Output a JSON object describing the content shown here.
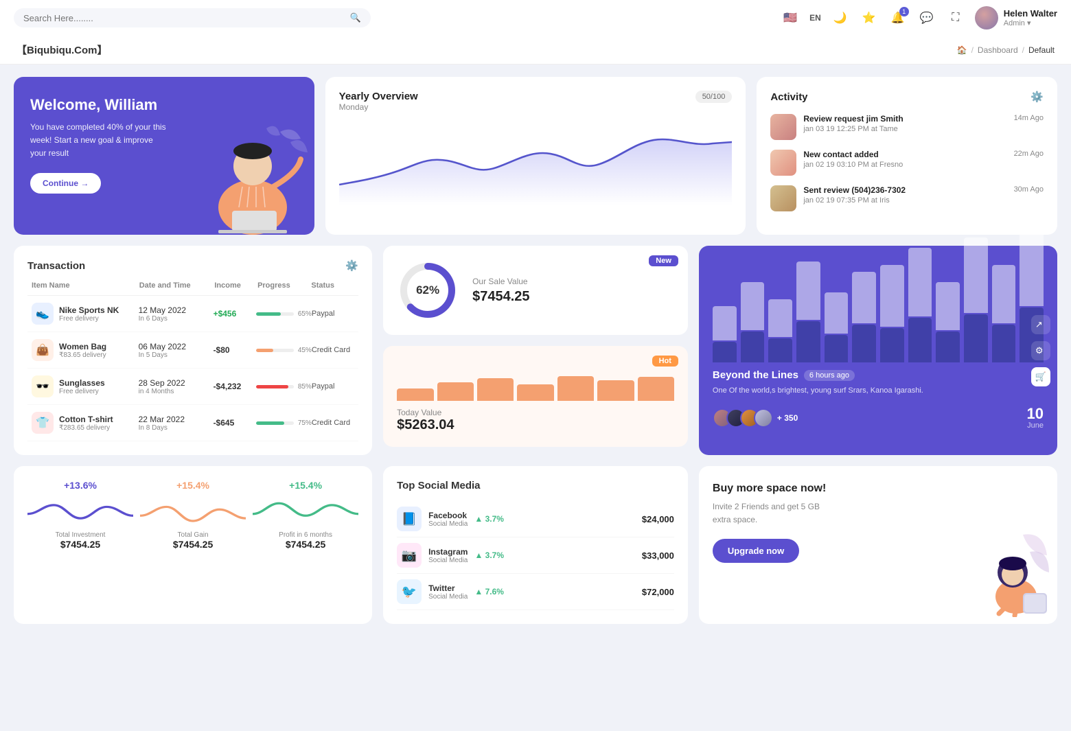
{
  "topnav": {
    "search_placeholder": "Search Here........",
    "lang": "EN",
    "user_name": "Helen Walter",
    "user_role": "Admin ▾",
    "notification_count": "1"
  },
  "breadcrumb": {
    "brand": "【Biqubiqu.Com】",
    "path": [
      "Dashboard",
      "Default"
    ]
  },
  "welcome": {
    "title": "Welcome, William",
    "subtitle": "You have completed 40% of your this week! Start a new goal & improve your result",
    "button": "Continue →"
  },
  "yearly": {
    "title": "Yearly Overview",
    "badge": "50/100",
    "subtitle": "Monday"
  },
  "activity": {
    "title": "Activity",
    "items": [
      {
        "title": "Review request jim Smith",
        "sub": "jan 03 19 12:25 PM at Tame",
        "time": "14m Ago"
      },
      {
        "title": "New contact added",
        "sub": "jan 02 19 03:10 PM at Fresno",
        "time": "22m Ago"
      },
      {
        "title": "Sent review (504)236-7302",
        "sub": "jan 02 19 07:35 PM at Iris",
        "time": "30m Ago"
      }
    ]
  },
  "transaction": {
    "title": "Transaction",
    "columns": [
      "Item Name",
      "Date and Time",
      "Income",
      "Progress",
      "Status"
    ],
    "rows": [
      {
        "name": "Nike Sports NK",
        "sub": "Free delivery",
        "icon": "👟",
        "icon_bg": "#e8f0ff",
        "date": "12 May 2022",
        "days": "In 6 Days",
        "income": "+$456",
        "positive": true,
        "progress": 65,
        "progress_color": "#44bb88",
        "status": "Paypal"
      },
      {
        "name": "Women Bag",
        "sub": "₹83.65 delivery",
        "icon": "👜",
        "icon_bg": "#fff0e8",
        "date": "06 May 2022",
        "days": "In 5 Days",
        "income": "-$80",
        "positive": false,
        "progress": 45,
        "progress_color": "#f4a070",
        "status": "Credit Card"
      },
      {
        "name": "Sunglasses",
        "sub": "Free delivery",
        "icon": "🕶️",
        "icon_bg": "#fff8e0",
        "date": "28 Sep 2022",
        "days": "in 4 Months",
        "income": "-$4,232",
        "positive": false,
        "progress": 85,
        "progress_color": "#ee4444",
        "status": "Paypal"
      },
      {
        "name": "Cotton T-shirt",
        "sub": "₹283.65 delivery",
        "icon": "👕",
        "icon_bg": "#ffe8e8",
        "date": "22 Mar 2022",
        "days": "In 8 Days",
        "income": "-$645",
        "positive": false,
        "progress": 75,
        "progress_color": "#44bb88",
        "status": "Credit Card"
      }
    ]
  },
  "sale_value": {
    "badge": "New",
    "percent": "62%",
    "label": "Our Sale Value",
    "value": "$7454.25"
  },
  "today_value": {
    "badge": "Hot",
    "label": "Today Value",
    "value": "$5263.04",
    "bars": [
      30,
      45,
      55,
      40,
      60,
      50,
      58
    ]
  },
  "beyond": {
    "title": "Beyond the Lines",
    "time_ago": "6 hours ago",
    "desc": "One Of the world,s brightest, young surf Srars, Kanoa Igarashi.",
    "more_count": "+ 350",
    "date_num": "10",
    "date_mon": "June"
  },
  "stats": [
    {
      "pct": "+13.6%",
      "color": "purple",
      "label": "Total Investment",
      "value": "$7454.25"
    },
    {
      "pct": "+15.4%",
      "color": "orange",
      "label": "Total Gain",
      "value": "$7454.25"
    },
    {
      "pct": "+15.4%",
      "color": "green",
      "label": "Profit in 6 months",
      "value": "$7454.25"
    }
  ],
  "social": {
    "title": "Top Social Media",
    "items": [
      {
        "name": "Facebook",
        "sub": "Social Media",
        "icon": "📘",
        "icon_bg": "#e8f0ff",
        "pct": "3.7%",
        "amount": "$24,000"
      },
      {
        "name": "Instagram",
        "sub": "Social Media",
        "icon": "📷",
        "icon_bg": "#ffe8f8",
        "pct": "3.7%",
        "amount": "$33,000"
      },
      {
        "name": "Twitter",
        "sub": "Social Media",
        "icon": "🐦",
        "icon_bg": "#e8f4ff",
        "pct": "7.6%",
        "amount": "$72,000"
      }
    ]
  },
  "buy_space": {
    "title": "Buy more space now!",
    "sub": "Invite 2 Friends and get 5 GB extra space.",
    "button": "Upgrade now"
  },
  "bar_chart": {
    "bars": [
      {
        "dark": 30,
        "light": 50
      },
      {
        "dark": 45,
        "light": 70
      },
      {
        "dark": 35,
        "light": 55
      },
      {
        "dark": 60,
        "light": 85
      },
      {
        "dark": 40,
        "light": 60
      },
      {
        "dark": 55,
        "light": 75
      },
      {
        "dark": 50,
        "light": 90
      },
      {
        "dark": 65,
        "light": 100
      },
      {
        "dark": 45,
        "light": 70
      },
      {
        "dark": 70,
        "light": 110
      },
      {
        "dark": 55,
        "light": 85
      },
      {
        "dark": 80,
        "light": 120
      }
    ]
  }
}
